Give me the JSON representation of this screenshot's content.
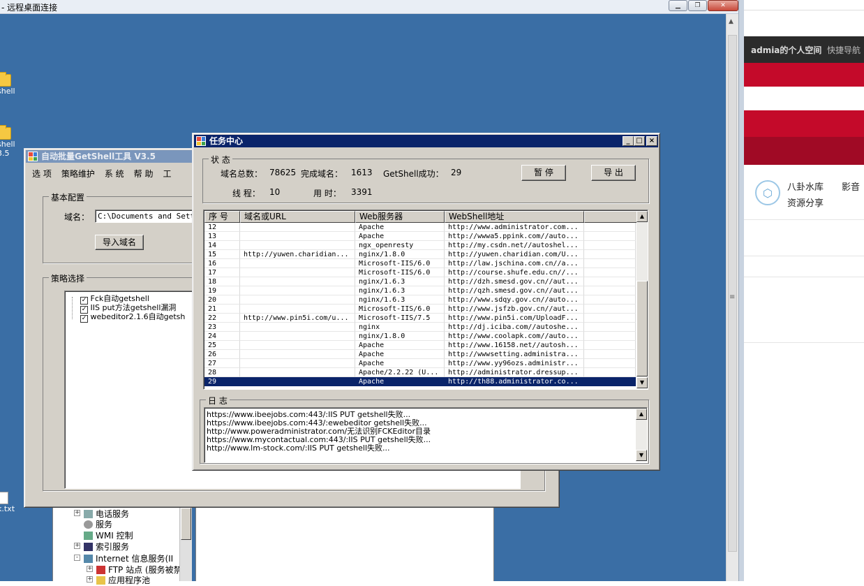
{
  "remote_desktop": {
    "title": "- 远程桌面连接",
    "desktop_icons": [
      {
        "label": "shell",
        "icon": "folder-icon"
      },
      {
        "label": "shell",
        "icon": "folder-icon"
      },
      {
        "label": "3.5",
        "icon": "folder-icon"
      },
      {
        "label": "k.txt",
        "icon": "text-file-icon"
      }
    ]
  },
  "browser": {
    "user_space": "admia的个人空间",
    "quick_nav": "快捷导航",
    "links": [
      "八卦水库",
      "影音",
      "资源分享"
    ]
  },
  "main_window": {
    "title": "自动批量GetShell工具 V3.5",
    "menu": [
      "选 项",
      "策略维护",
      "系 统",
      "帮 助",
      "工"
    ],
    "basic_config": {
      "label": "基本配置",
      "domain_label": "域名：",
      "domain_value": "C:\\Documents and Settin",
      "import_button": "导入域名"
    },
    "strategy": {
      "label": "策略选择",
      "items": [
        "Fck自动getshell",
        "IIS put方法getshell漏洞",
        "webeditor2.1.6自动getsh"
      ]
    }
  },
  "tree": {
    "items": [
      {
        "label": "电话服务",
        "expander": "+"
      },
      {
        "label": "服务",
        "expander": ""
      },
      {
        "label": "WMI 控制",
        "expander": ""
      },
      {
        "label": "索引服务",
        "expander": "+"
      },
      {
        "label": "Internet 信息服务(II",
        "expander": "-"
      },
      {
        "label": "FTP 站点 (服务被禁",
        "expander": "+"
      },
      {
        "label": "应用程序池",
        "expander": "+"
      }
    ]
  },
  "task_center": {
    "title": "任务中心",
    "status_label": "状 态",
    "stats": {
      "total_label": "域名总数：",
      "total_value": "78625",
      "done_label": "完成域名：",
      "done_value": "1613",
      "success_label": "GetShell成功：",
      "success_value": "29",
      "threads_label": "线 程：",
      "threads_value": "10",
      "time_label": "用 时：",
      "time_value": "3391"
    },
    "pause_button": "暂 停",
    "export_button": "导 出",
    "columns": [
      "序 号",
      "域名或URL",
      "Web服务器",
      "WebShell地址"
    ],
    "rows": [
      [
        "12",
        "",
        "Apache",
        "http://www.administrator.com..."
      ],
      [
        "13",
        "",
        "Apache",
        "http://wwwa5.ppink.com//auto..."
      ],
      [
        "14",
        "",
        "ngx_openresty",
        "http://my.csdn.net//autoshel..."
      ],
      [
        "15",
        "http://yuwen.charidian...",
        "nginx/1.8.0",
        "http://yuwen.charidian.com/U..."
      ],
      [
        "16",
        "",
        "Microsoft-IIS/6.0",
        "http://law.jschina.com.cn//a..."
      ],
      [
        "17",
        "",
        "Microsoft-IIS/6.0",
        "http://course.shufe.edu.cn//..."
      ],
      [
        "18",
        "",
        "nginx/1.6.3",
        "http://dzh.smesd.gov.cn//aut..."
      ],
      [
        "19",
        "",
        "nginx/1.6.3",
        "http://qzh.smesd.gov.cn//aut..."
      ],
      [
        "20",
        "",
        "nginx/1.6.3",
        "http://www.sdqy.gov.cn//auto..."
      ],
      [
        "21",
        "",
        "Microsoft-IIS/6.0",
        "http://www.jsfzb.gov.cn//aut..."
      ],
      [
        "22",
        "http://www.pin5i.com/u...",
        "Microsoft-IIS/7.5",
        "http://www.pin5i.com/UploadF..."
      ],
      [
        "23",
        "",
        "nginx",
        "http://dj.iciba.com//autoshe..."
      ],
      [
        "24",
        "",
        "nginx/1.8.0",
        "http://www.coolapk.com//auto..."
      ],
      [
        "25",
        "",
        "Apache",
        "http://www.16158.net//autosh..."
      ],
      [
        "26",
        "",
        "Apache",
        "http://wwwsetting.administra..."
      ],
      [
        "27",
        "",
        "Apache",
        "http://www.yy96ozs.administr..."
      ],
      [
        "28",
        "",
        "Apache/2.2.22 (U...",
        "http://administrator.dressup..."
      ],
      [
        "29",
        "",
        "Apache",
        "http://th88.administrator.co..."
      ]
    ],
    "selected_row": "29",
    "log_label": "日 志",
    "log_lines": [
      "https://www.ibeejobs.com:443/:IIS PUT getshell失败...",
      "https://www.ibeejobs.com:443/:ewebeditor getshell失败...",
      "http://www.poweradministrator.com/无法识别FCKEditor目录",
      "https://www.mycontactual.com:443/:IIS PUT getshell失败...",
      "http://www.lm-stock.com/:IIS PUT getshell失败..."
    ]
  },
  "colors": {
    "desktop": "#3a6ea5",
    "active_title": "#0a246a",
    "inactive_title": "#7a96bc",
    "face": "#d4d0c8",
    "browser_red": "#c40a2a",
    "browser_dark_red": "#a00a25"
  }
}
